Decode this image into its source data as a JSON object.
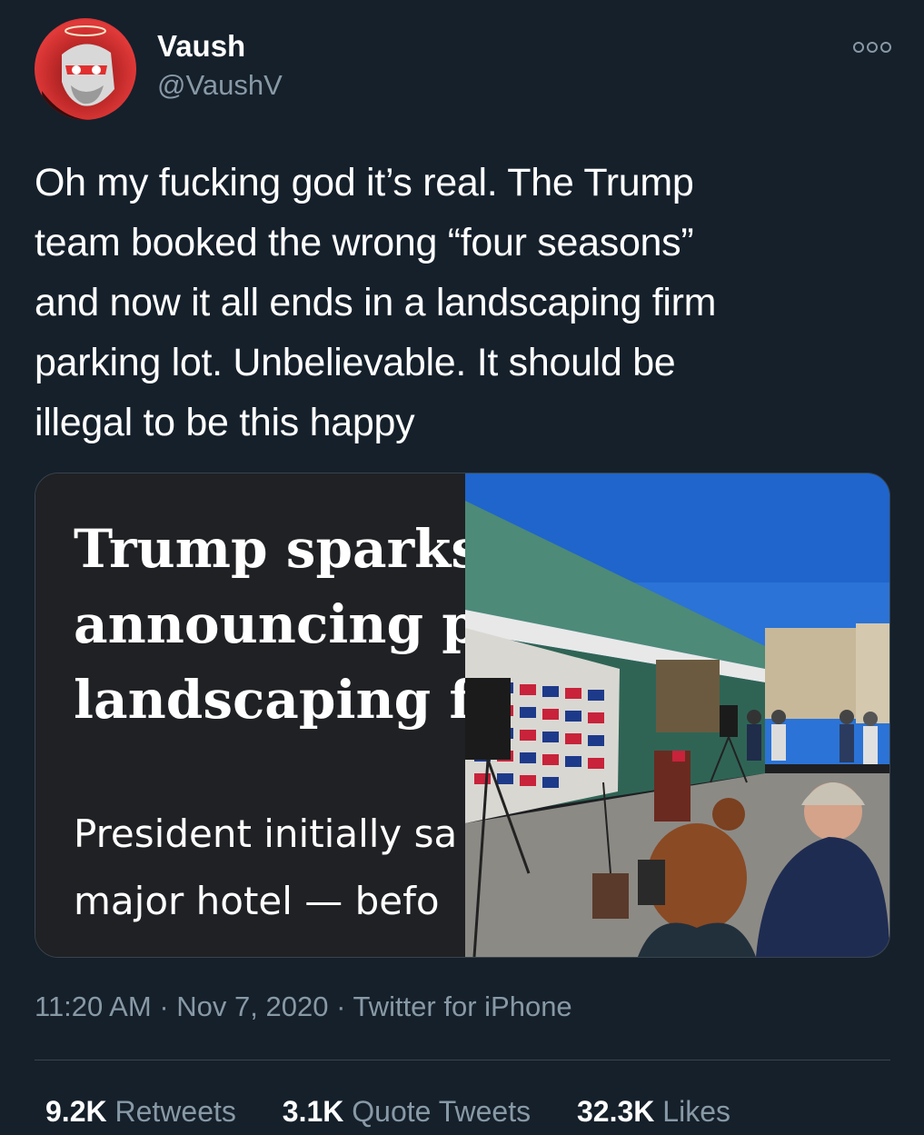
{
  "user": {
    "display_name": "Vaush",
    "handle": "@VaushV"
  },
  "tweet": {
    "text": "Oh my fucking god it’s real. The Trump\nteam booked the wrong “four seasons”\nand now it all ends in a landscaping firm\nparking lot. Unbelievable. It should be\nillegal to be this happy"
  },
  "media": {
    "headline": "Trump sparks\nannouncing p\nlandscaping f",
    "subheadline": "President initially sa\nmajor hotel — befo"
  },
  "meta": {
    "time": "11:20 AM",
    "date": "Nov 7, 2020",
    "source": "Twitter for iPhone",
    "separator": "·"
  },
  "stats": {
    "retweets_count": "9.2K",
    "retweets_label": "Retweets",
    "quotes_count": "3.1K",
    "quotes_label": "Quote Tweets",
    "likes_count": "32.3K",
    "likes_label": "Likes"
  },
  "icons": {
    "more": "more-options-icon",
    "avatar": "avatar"
  },
  "colors": {
    "background": "#15202b",
    "secondary_text": "#8899a6",
    "divider": "#38444d"
  }
}
